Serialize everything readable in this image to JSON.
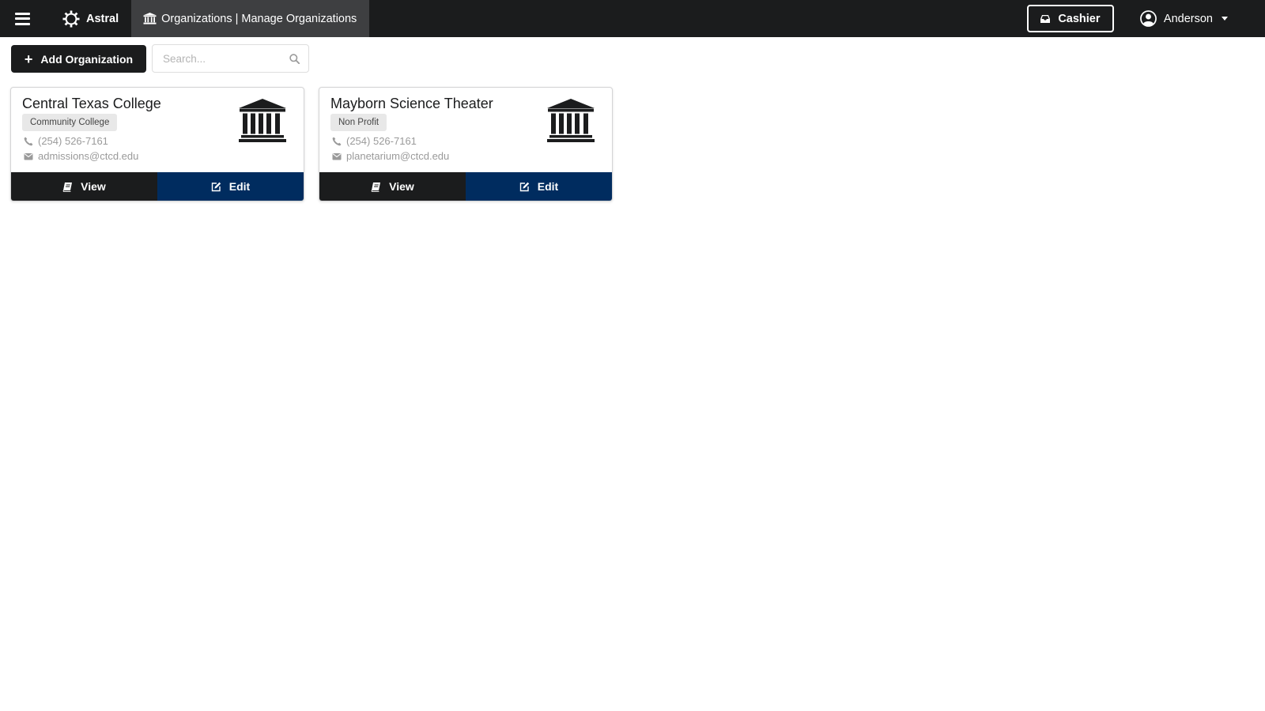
{
  "app": {
    "brand_name": "Astral",
    "active_page": "Organizations | Manage Organizations"
  },
  "header": {
    "cashier_label": "Cashier",
    "user_name": "Anderson"
  },
  "toolbar": {
    "add_label": "Add Organization",
    "search_placeholder": "Search...",
    "search_value": ""
  },
  "organizations": [
    {
      "name": "Central Texas College",
      "type": "Community College",
      "phone": "(254) 526-7161",
      "email": "admissions@ctcd.edu",
      "view_label": "View",
      "edit_label": "Edit"
    },
    {
      "name": "Mayborn Science Theater",
      "type": "Non Profit",
      "phone": "(254) 526-7161",
      "email": "planetarium@ctcd.edu",
      "view_label": "View",
      "edit_label": "Edit"
    }
  ],
  "icons": {
    "menu": "hamburger-icon",
    "brand": "gear-icon",
    "nav": "institution-icon",
    "cashier": "inbox-icon",
    "user": "user-circle-icon",
    "add": "plus-icon",
    "search": "search-icon",
    "phone": "phone-icon",
    "email": "envelope-icon",
    "view": "book-icon",
    "edit": "edit-icon"
  },
  "colors": {
    "topbar": "#1b1c1d",
    "active_tab": "#3e3f41",
    "edit_button": "#002c5f",
    "view_button": "#1b1c1d"
  }
}
